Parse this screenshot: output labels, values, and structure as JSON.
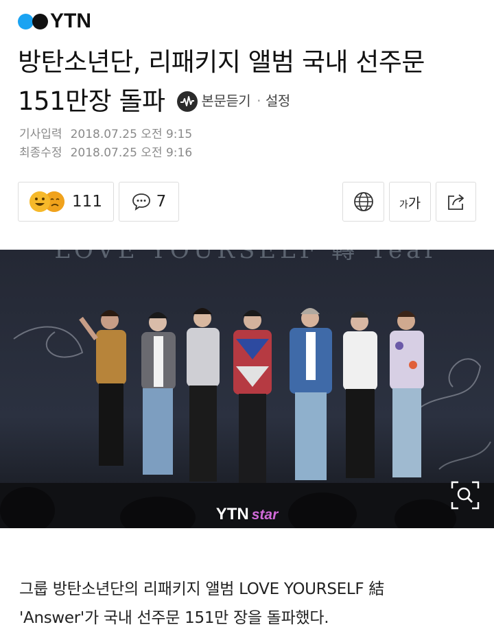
{
  "logo": {
    "text": "YTN",
    "colors": {
      "blue": "#1aa3f2",
      "black": "#111111"
    }
  },
  "headline": {
    "line1": "방탄소년단, 리패키지 앨범 국내 선주문",
    "line2": "151만장 돌파"
  },
  "listen": {
    "icon": "audio-wave-icon",
    "label": "본문듣기",
    "sep": "·",
    "settings": "설정"
  },
  "meta": {
    "published_label": "기사입력",
    "published": "2018.07.25 오전 9:15",
    "updated_label": "최종수정",
    "updated": "2018.07.25 오전 9:16"
  },
  "actions": {
    "reactions_count": "111",
    "comments_count": "7",
    "font_label_small": "가",
    "font_label_large": "가"
  },
  "photo": {
    "banner": "LOVE YOURSELF 轉 Tear",
    "watermark": "YTN",
    "watermark_star": "star"
  },
  "article": {
    "line1": "그룹 방탄소년단의 리패키지 앨범 LOVE YOURSELF 結",
    "line2": "'Answer'가 국내 선주문 151만 장을 돌파했다."
  }
}
